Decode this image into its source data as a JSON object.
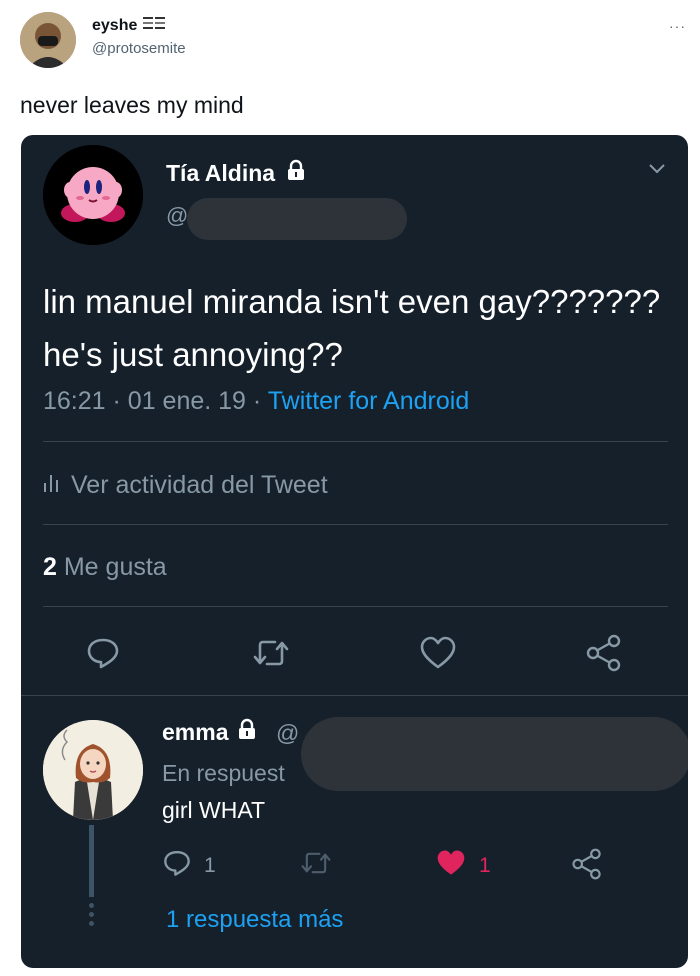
{
  "outer": {
    "display_name": "eyshe",
    "handle": "@protosemite",
    "more_label": "···",
    "text": "never leaves my mind"
  },
  "screenshot": {
    "author": {
      "name": "Tía Aldina",
      "handle_prefix": "@"
    },
    "text": "lin manuel miranda isn't even gay??????? he's just annoying??",
    "time": "16:21",
    "date": "01 ene. 19",
    "source": "Twitter for Android",
    "activity_label": "Ver actividad del Tweet",
    "likes_count": "2",
    "likes_label": "Me gusta",
    "reply": {
      "name": "emma",
      "handle_prefix": "@",
      "reply_to_label": "En respuest",
      "text": "girl WHAT",
      "reply_count": "1",
      "like_count": "1",
      "more_replies_label": "1 respuesta más"
    }
  },
  "colors": {
    "card_bg": "#15202b",
    "link_blue": "#1da1f2",
    "muted": "#8899a6",
    "like_red": "#e0245e"
  },
  "icons": [
    "lock-icon",
    "chevron-down-icon",
    "activity-chart-icon",
    "reply-icon",
    "retweet-icon",
    "like-icon",
    "share-icon"
  ]
}
